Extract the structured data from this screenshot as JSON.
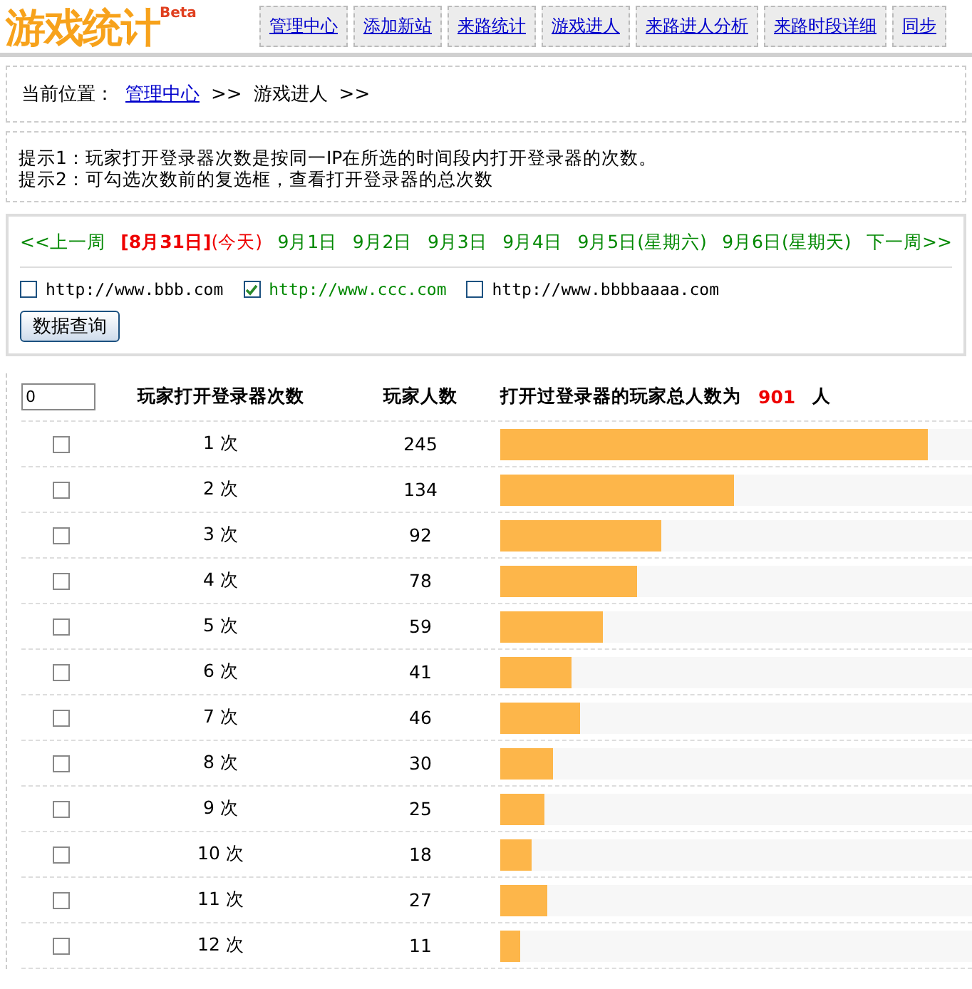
{
  "header": {
    "logo": "游戏统计",
    "logo_badge": "Beta",
    "nav": [
      {
        "label": "管理中心",
        "selected": false
      },
      {
        "label": "添加新站",
        "selected": false
      },
      {
        "label": "来路统计",
        "selected": false
      },
      {
        "label": "游戏进人",
        "selected": false
      },
      {
        "label": "来路进人分析",
        "selected": false
      },
      {
        "label": "来路时段详细",
        "selected": false
      },
      {
        "label": "同步",
        "selected": false
      }
    ]
  },
  "breadcrumb": {
    "label": "当前位置：",
    "link": "管理中心",
    "separator": ">>",
    "current": "游戏进人",
    "trail": ">>"
  },
  "tips": [
    "提示1：玩家打开登录器次数是按同一IP在所选的时间段内打开登录器的次数。",
    "提示2：可勾选次数前的复选框，查看打开登录器的总次数"
  ],
  "date_nav": {
    "prev": "<<上一周",
    "next": "下一周>>",
    "days": [
      {
        "label": "**[8月31日]**(今天)",
        "selected": true
      },
      {
        "label": "9月1日",
        "selected": false
      },
      {
        "label": "9月2日",
        "selected": false
      },
      {
        "label": "9月3日",
        "selected": false
      },
      {
        "label": "9月4日",
        "selected": false
      },
      {
        "label": "9月5日(星期六)",
        "selected": false
      },
      {
        "label": "9月6日(星期天)",
        "selected": false
      }
    ]
  },
  "sites": [
    {
      "label": "http://www.bbb.com",
      "checked": false
    },
    {
      "label": "http://www.ccc.com",
      "checked": true
    },
    {
      "label": "http://www.bbbbaaaa.com",
      "checked": false
    }
  ],
  "query_button": "数据查询",
  "table": {
    "filter_value": "0",
    "col_times": "玩家打开登录器次数",
    "col_players": "玩家人数",
    "total_label": "打开过登录器的玩家总人数为",
    "total_value": "901",
    "total_unit": "人",
    "rows": [
      {
        "times": "1 次",
        "players": "245",
        "checked": false,
        "level": 0.907
      },
      {
        "times": "2 次",
        "players": "134",
        "checked": false,
        "level": 0.496
      },
      {
        "times": "3 次",
        "players": "92",
        "checked": false,
        "level": 0.341
      },
      {
        "times": "4 次",
        "players": "78",
        "checked": false,
        "level": 0.289
      },
      {
        "times": "5 次",
        "players": "59",
        "checked": false,
        "level": 0.219
      },
      {
        "times": "6 次",
        "players": "41",
        "checked": false,
        "level": 0.152
      },
      {
        "times": "7 次",
        "players": "46",
        "checked": false,
        "level": 0.17
      },
      {
        "times": "8 次",
        "players": "30",
        "checked": false,
        "level": 0.111
      },
      {
        "times": "9 次",
        "players": "25",
        "checked": false,
        "level": 0.093
      },
      {
        "times": "10 次",
        "players": "18",
        "checked": false,
        "level": 0.067
      },
      {
        "times": "11 次",
        "players": "27",
        "checked": false,
        "level": 0.1
      },
      {
        "times": "12 次",
        "players": "11",
        "checked": false,
        "level": 0.041
      }
    ]
  }
}
